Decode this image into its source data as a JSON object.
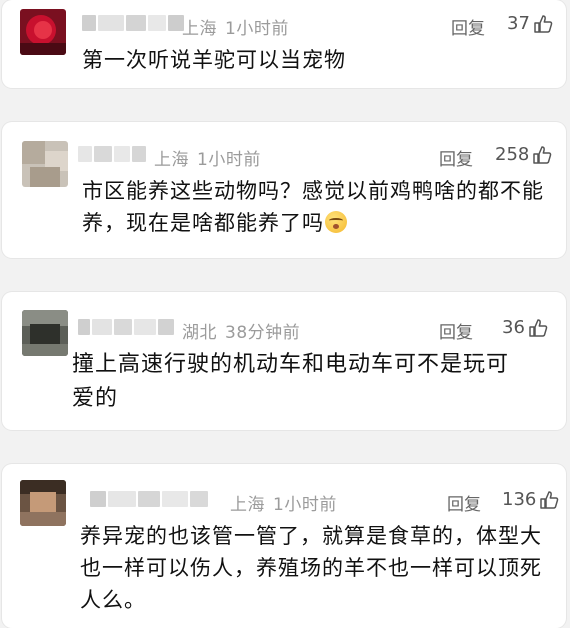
{
  "comments": [
    {
      "location": "上海",
      "time": "1小时前",
      "reply_label": "回复",
      "likes": "37",
      "text_lines": [
        "第一次听说羊驼可以当宠物"
      ]
    },
    {
      "location": "上海",
      "time": "1小时前",
      "reply_label": "回复",
      "likes": "258",
      "text_lines": [
        "市区能养这些动物吗？感觉以前鸡鸭啥的都不能",
        "养，现在是啥都能养了吗"
      ],
      "emoji": "face-emoji"
    },
    {
      "location": "湖北",
      "time": "38分钟前",
      "reply_label": "回复",
      "likes": "36",
      "text_lines": [
        "撞上高速行驶的机动车和电动车可不是玩可",
        "爱的"
      ]
    },
    {
      "location": "上海",
      "time": "1小时前",
      "reply_label": "回复",
      "likes": "136",
      "text_lines": [
        "养异宠的也该管一管了，就算是食草的，体型大",
        "也一样可以伤人，养殖场的羊不也一样可以顶死",
        "人么。"
      ]
    }
  ],
  "icons": {
    "like": "thumbs-up-icon",
    "emoji": "grinning-face-emoji"
  },
  "colors": {
    "background": "#f2f2f2",
    "card": "#ffffff",
    "meta_text": "#9b9b9b",
    "body_text": "#111111"
  }
}
